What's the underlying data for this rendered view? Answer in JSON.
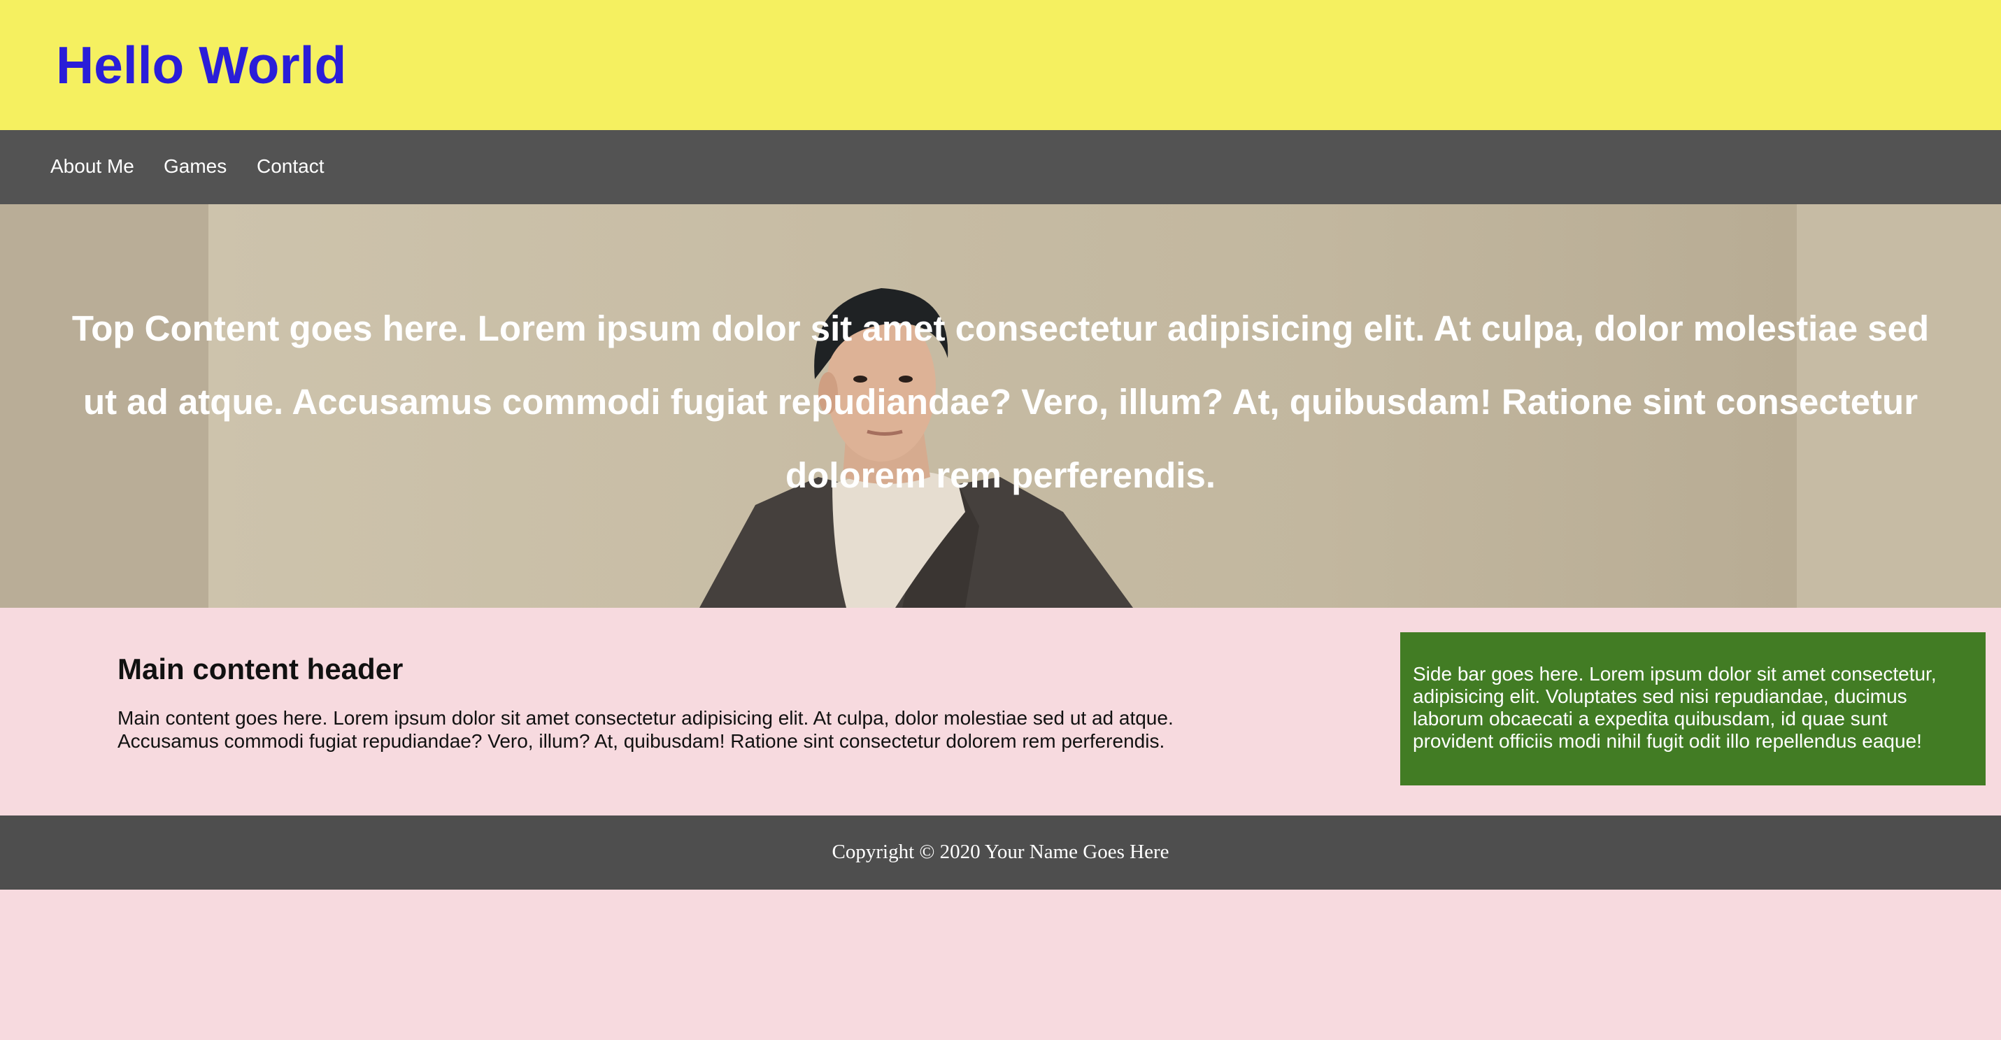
{
  "header": {
    "title": "Hello World"
  },
  "nav": {
    "items": [
      {
        "label": "About Me"
      },
      {
        "label": "Games"
      },
      {
        "label": "Contact"
      }
    ]
  },
  "hero": {
    "text": "Top Content goes here. Lorem ipsum dolor sit amet consectetur adipisicing elit. At culpa, dolor molestiae sed ut ad atque. Accusamus commodi fugiat repudiandae? Vero, illum? At, quibusdam! Ratione sint consectetur dolorem rem perferendis."
  },
  "main": {
    "header": "Main content header",
    "text": "Main content goes here. Lorem ipsum dolor sit amet consectetur adipisicing elit. At culpa, dolor molestiae sed ut ad atque. Accusamus commodi fugiat repudiandae? Vero, illum? At, quibusdam! Ratione sint consectetur dolorem rem perferendis."
  },
  "sidebar": {
    "text": "Side bar goes here. Lorem ipsum dolor sit amet consectetur, adipisicing elit. Voluptates sed nisi repudiandae, ducimus laborum obcaecati a expedita quibusdam, id quae sunt provident officiis modi nihil fugit odit illo repellendus eaque!"
  },
  "footer": {
    "text": "Copyright © 2020 Your Name Goes Here"
  },
  "colors": {
    "header_bg": "#f5f060",
    "title": "#2a1ed8",
    "nav_bg": "#535353",
    "page_bg": "#f7dadf",
    "sidebar_bg": "#427c24",
    "footer_bg": "#4e4e4e"
  }
}
